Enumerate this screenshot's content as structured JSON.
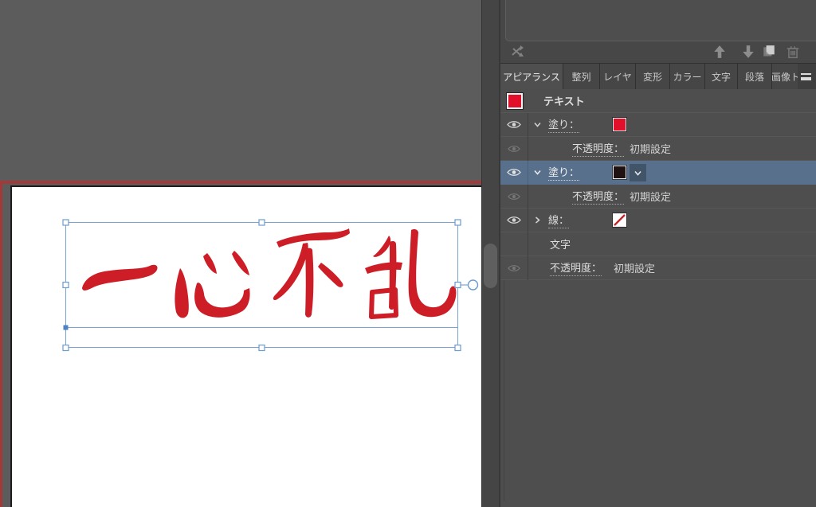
{
  "canvas": {
    "text": "一心不乱",
    "text_color": "#cd1d26",
    "frame_color": "#a23a3a",
    "selection_color": "#7ba3d4"
  },
  "panel_icons": {
    "swap": "swap-arrows-icon",
    "up": "arrow-up-icon",
    "down": "arrow-down-icon",
    "new": "new-item-icon",
    "trash": "trash-icon",
    "menu": "hamburger-menu-icon"
  },
  "tabs": {
    "items": [
      {
        "label": "アピアランス",
        "active": true
      },
      {
        "label": "整列"
      },
      {
        "label": "レイヤ"
      },
      {
        "label": "変形"
      },
      {
        "label": "カラー"
      },
      {
        "label": "文字"
      },
      {
        "label": "段落"
      },
      {
        "label": "画像ト"
      }
    ]
  },
  "appearance": {
    "object_row": {
      "label": "テキスト",
      "swatch_color": "#e0102a"
    },
    "rows": [
      {
        "label": "塗り：",
        "swatch": "#e0102a"
      },
      {
        "label": "不透明度：",
        "value": "初期設定"
      },
      {
        "label": "塗り：",
        "swatch": "#201113",
        "selected": true
      },
      {
        "label": "不透明度：",
        "value": "初期設定"
      },
      {
        "label": "線：",
        "swatch": "none"
      },
      {
        "label": "文字"
      },
      {
        "label": "不透明度：",
        "value": "初期設定"
      }
    ]
  }
}
